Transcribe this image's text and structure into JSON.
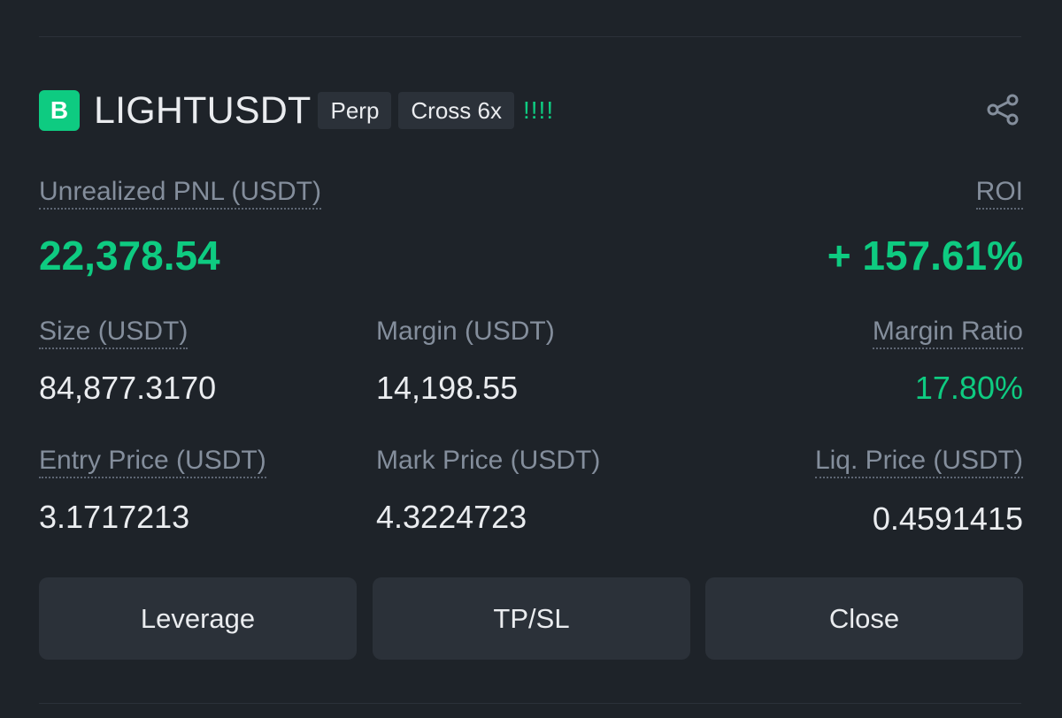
{
  "header": {
    "logo_letter": "B",
    "symbol": "LIGHTUSDT",
    "tags": [
      "Perp",
      "Cross 6x"
    ],
    "signal": "!!!!",
    "share_icon": "share-icon"
  },
  "pnl": {
    "label": "Unrealized PNL (USDT)",
    "value": "22,378.54"
  },
  "roi": {
    "label": "ROI",
    "value": "+ 157.61%"
  },
  "size": {
    "label": "Size (USDT)",
    "value": "84,877.3170"
  },
  "margin": {
    "label": "Margin (USDT)",
    "value": "14,198.55"
  },
  "margin_ratio": {
    "label": "Margin Ratio",
    "value": "17.80%"
  },
  "entry_price": {
    "label": "Entry Price (USDT)",
    "value": "3.1717213"
  },
  "mark_price": {
    "label": "Mark Price (USDT)",
    "value": "4.3224723"
  },
  "liq_price": {
    "label": "Liq. Price (USDT)",
    "value": "0.4591415"
  },
  "buttons": {
    "leverage": "Leverage",
    "tpsl": "TP/SL",
    "close": "Close"
  },
  "colors": {
    "background": "#1e2329",
    "positive": "#0ecb81",
    "muted": "#848e9c",
    "button_bg": "#2b3139"
  }
}
